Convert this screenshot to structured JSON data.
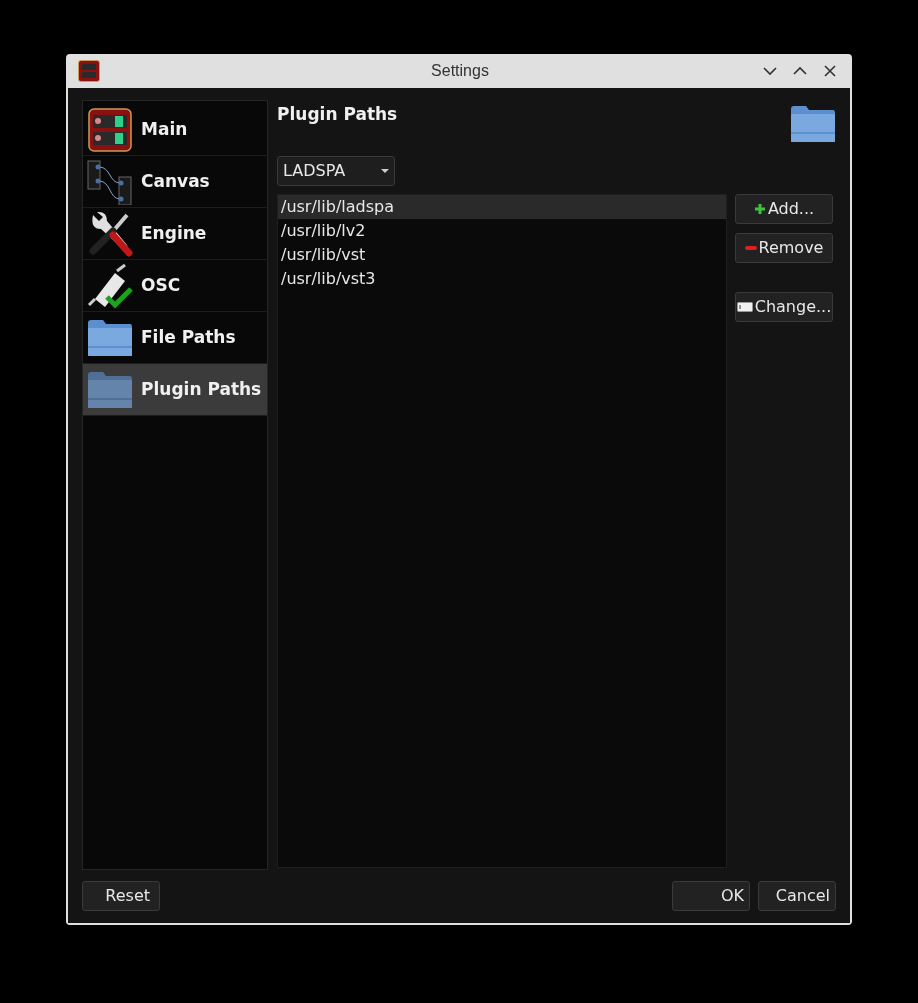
{
  "window": {
    "title": "Settings"
  },
  "sidebar": {
    "items": [
      {
        "label": "Main",
        "kind": "main",
        "selected": false
      },
      {
        "label": "Canvas",
        "kind": "canvas",
        "selected": false
      },
      {
        "label": "Engine",
        "kind": "engine",
        "selected": false
      },
      {
        "label": "OSC",
        "kind": "osc",
        "selected": false
      },
      {
        "label": "File Paths",
        "kind": "folder",
        "selected": false
      },
      {
        "label": "Plugin Paths",
        "kind": "folder",
        "selected": true
      }
    ]
  },
  "panel": {
    "title": "Plugin Paths",
    "type_dropdown": {
      "value": "LADSPA"
    },
    "paths": [
      {
        "path": "/usr/lib/ladspa",
        "selected": true
      },
      {
        "path": "/usr/lib/lv2",
        "selected": false
      },
      {
        "path": "/usr/lib/vst",
        "selected": false
      },
      {
        "path": "/usr/lib/vst3",
        "selected": false
      }
    ],
    "buttons": [
      {
        "label": "Add...",
        "kind": "add"
      },
      {
        "label": "Remove",
        "kind": "remove"
      },
      {
        "label": "Change...",
        "kind": "change"
      }
    ]
  },
  "footer": {
    "left_buttons": [
      "Reset"
    ],
    "right_buttons": [
      "OK",
      "Cancel"
    ]
  }
}
